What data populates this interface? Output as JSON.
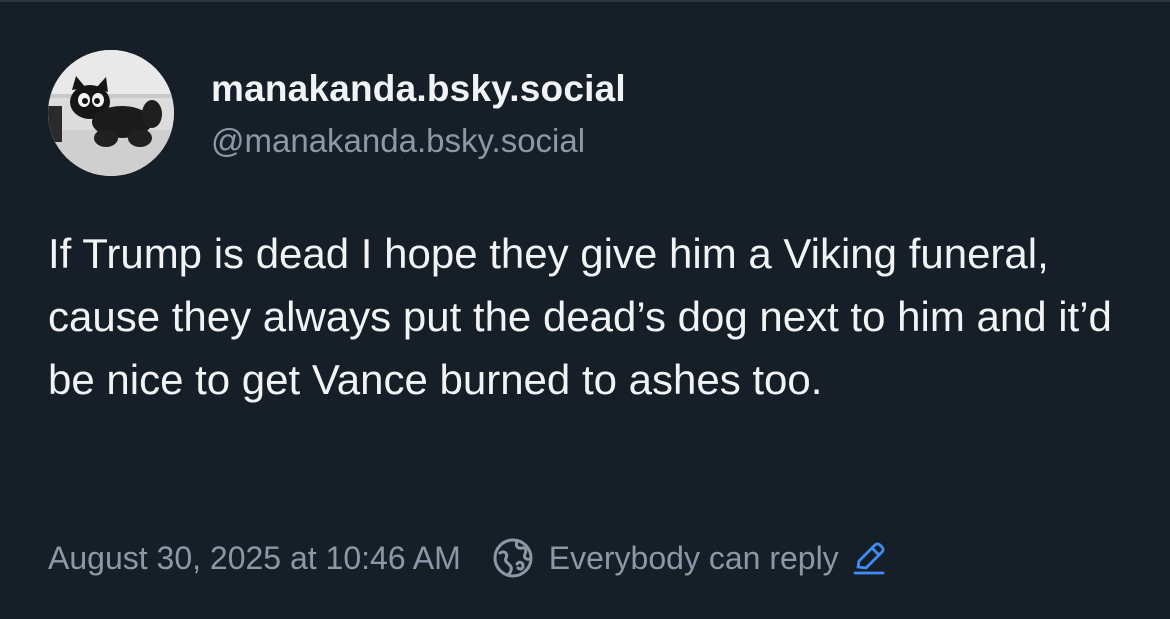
{
  "author": {
    "display_name": "manakanda.bsky.social",
    "handle": "@manakanda.bsky.social"
  },
  "post": {
    "text": "If Trump is dead I hope they give him a Viking funeral, cause they always put the dead’s dog next to him and it’d be nice to get Vance burned to ashes too.",
    "timestamp": "August 30, 2025 at 10:46 AM",
    "reply_setting": "Everybody can reply"
  },
  "icons": {
    "globe": "globe-icon",
    "edit": "pencil-edit-icon"
  },
  "colors": {
    "background": "#161e27",
    "primary_text": "#f1f3f5",
    "secondary_text": "#8b98a8",
    "accent": "#3f8cf5"
  }
}
